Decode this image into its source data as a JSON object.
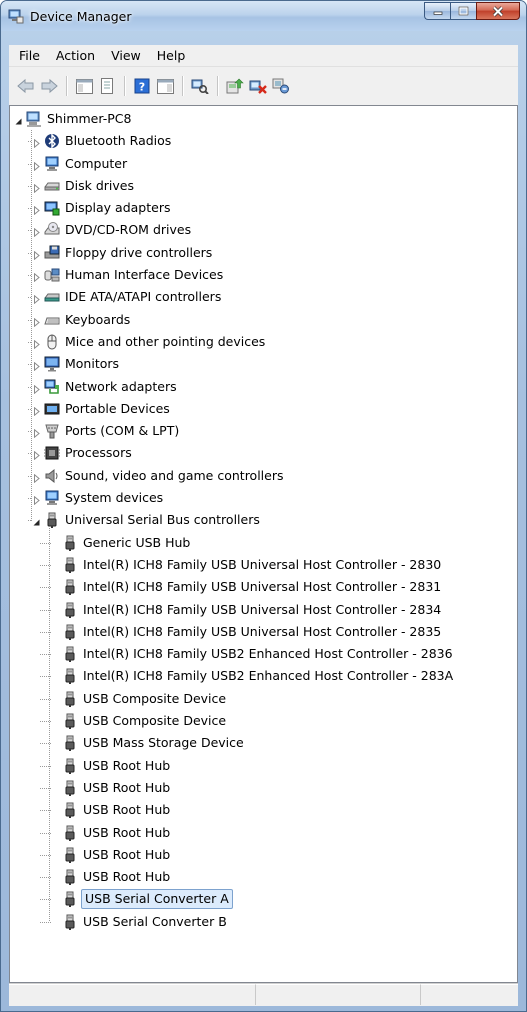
{
  "window": {
    "title": "Device Manager"
  },
  "menu": [
    "File",
    "Action",
    "View",
    "Help"
  ],
  "toolbar": [
    "back-arrow-icon",
    "forward-arrow-icon",
    "console-tree-icon",
    "properties-sheet-icon",
    "help-icon",
    "action-pane-icon",
    "scan-hardware-icon",
    "update-driver-icon",
    "uninstall-icon",
    "disable-device-icon"
  ],
  "tree": {
    "root": "Shimmer-PC8",
    "categories": [
      {
        "label": "Bluetooth Radios",
        "icon": "bluetooth-icon"
      },
      {
        "label": "Computer",
        "icon": "computer-icon"
      },
      {
        "label": "Disk drives",
        "icon": "disk-drive-icon"
      },
      {
        "label": "Display adapters",
        "icon": "display-adapter-icon"
      },
      {
        "label": "DVD/CD-ROM drives",
        "icon": "dvd-drive-icon"
      },
      {
        "label": "Floppy drive controllers",
        "icon": "floppy-controller-icon"
      },
      {
        "label": "Human Interface Devices",
        "icon": "hid-icon"
      },
      {
        "label": "IDE ATA/ATAPI controllers",
        "icon": "ide-controller-icon"
      },
      {
        "label": "Keyboards",
        "icon": "keyboard-icon"
      },
      {
        "label": "Mice and other pointing devices",
        "icon": "mouse-icon"
      },
      {
        "label": "Monitors",
        "icon": "monitor-icon"
      },
      {
        "label": "Network adapters",
        "icon": "network-adapter-icon"
      },
      {
        "label": "Portable Devices",
        "icon": "portable-device-icon"
      },
      {
        "label": "Ports (COM & LPT)",
        "icon": "port-icon"
      },
      {
        "label": "Processors",
        "icon": "processor-icon"
      },
      {
        "label": "Sound, video and game controllers",
        "icon": "speaker-icon"
      },
      {
        "label": "System devices",
        "icon": "system-device-icon"
      }
    ],
    "usb_category": "Universal Serial Bus controllers",
    "usb_devices": [
      "Generic USB Hub",
      "Intel(R) ICH8 Family USB Universal Host Controller - 2830",
      "Intel(R) ICH8 Family USB Universal Host Controller - 2831",
      "Intel(R) ICH8 Family USB Universal Host Controller - 2834",
      "Intel(R) ICH8 Family USB Universal Host Controller - 2835",
      "Intel(R) ICH8 Family USB2 Enhanced Host Controller - 2836",
      "Intel(R) ICH8 Family USB2 Enhanced Host Controller - 283A",
      "USB Composite Device",
      "USB Composite Device",
      "USB Mass Storage Device",
      "USB Root Hub",
      "USB Root Hub",
      "USB Root Hub",
      "USB Root Hub",
      "USB Root Hub",
      "USB Root Hub",
      "USB Serial Converter A",
      "USB Serial Converter B"
    ],
    "selected": "USB Serial Converter A"
  },
  "colors": {
    "selection_border": "#7da2ce",
    "selection_fill": "#dcebfc",
    "titlebar": "#b9d1ea"
  }
}
